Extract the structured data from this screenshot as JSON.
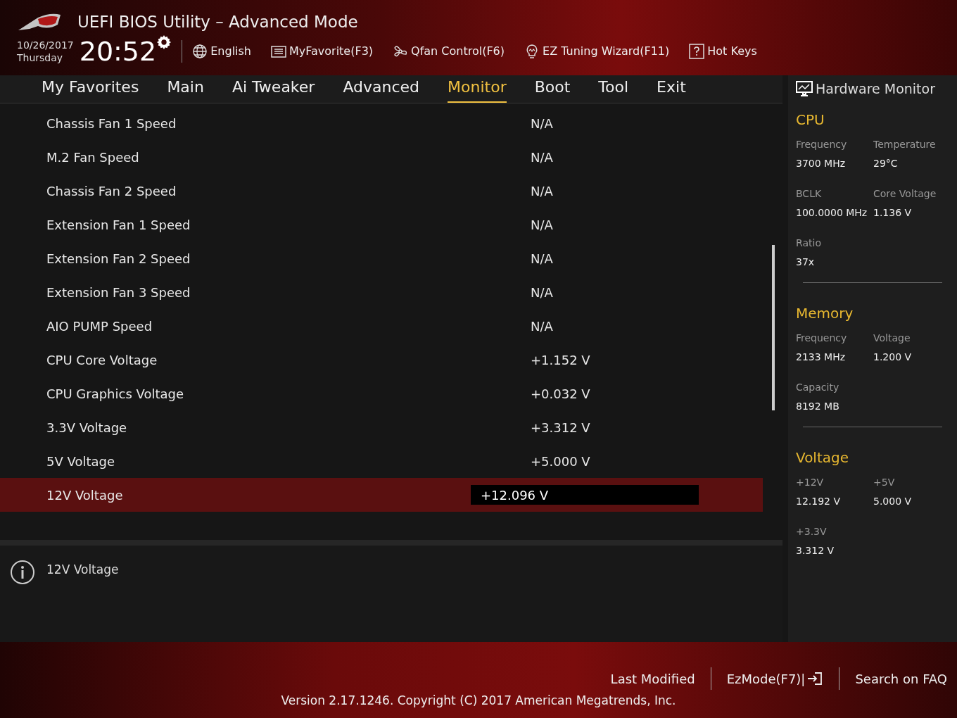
{
  "header": {
    "title": "UEFI BIOS Utility – Advanced Mode",
    "date": "10/26/2017",
    "day": "Thursday",
    "time": "20:52",
    "tools": [
      {
        "kind": "language",
        "label": "English"
      },
      {
        "kind": "favorite",
        "label": "MyFavorite(F3)"
      },
      {
        "kind": "fan",
        "label": "Qfan Control(F6)"
      },
      {
        "kind": "wizard",
        "label": "EZ Tuning Wizard(F11)"
      },
      {
        "kind": "hotkeys",
        "label": "Hot Keys"
      }
    ]
  },
  "tabs": [
    {
      "label": "My Favorites",
      "selected": false
    },
    {
      "label": "Main",
      "selected": false
    },
    {
      "label": "Ai Tweaker",
      "selected": false
    },
    {
      "label": "Advanced",
      "selected": false
    },
    {
      "label": "Monitor",
      "selected": true
    },
    {
      "label": "Boot",
      "selected": false
    },
    {
      "label": "Tool",
      "selected": false
    },
    {
      "label": "Exit",
      "selected": false
    }
  ],
  "rows": [
    {
      "label": "Chassis Fan 1 Speed",
      "value": "N/A",
      "selected": false
    },
    {
      "label": "M.2 Fan Speed",
      "value": "N/A",
      "selected": false
    },
    {
      "label": "Chassis Fan 2 Speed",
      "value": "N/A",
      "selected": false
    },
    {
      "label": "Extension Fan 1 Speed",
      "value": "N/A",
      "selected": false
    },
    {
      "label": "Extension Fan 2 Speed",
      "value": "N/A",
      "selected": false
    },
    {
      "label": "Extension Fan 3 Speed",
      "value": "N/A",
      "selected": false
    },
    {
      "label": "AIO PUMP Speed",
      "value": "N/A",
      "selected": false
    },
    {
      "label": "CPU Core Voltage",
      "value": "+1.152 V",
      "selected": false
    },
    {
      "label": "CPU Graphics Voltage",
      "value": "+0.032 V",
      "selected": false
    },
    {
      "label": "3.3V Voltage",
      "value": "+3.312 V",
      "selected": false
    },
    {
      "label": "5V Voltage",
      "value": "+5.000 V",
      "selected": false
    },
    {
      "label": "12V Voltage",
      "value": "+12.096 V",
      "selected": true
    }
  ],
  "help": {
    "text": "12V Voltage"
  },
  "hardware_monitor": {
    "title": "Hardware Monitor",
    "groups": [
      {
        "title": "CPU",
        "items": [
          {
            "label": "Frequency",
            "value": "3700 MHz"
          },
          {
            "label": "Temperature",
            "value": "29°C"
          },
          {
            "label": "BCLK",
            "value": "100.0000 MHz"
          },
          {
            "label": "Core Voltage",
            "value": "1.136 V"
          },
          {
            "label": "Ratio",
            "value": "37x"
          }
        ]
      },
      {
        "title": "Memory",
        "items": [
          {
            "label": "Frequency",
            "value": "2133 MHz"
          },
          {
            "label": "Voltage",
            "value": "1.200 V"
          },
          {
            "label": "Capacity",
            "value": "8192 MB"
          }
        ]
      },
      {
        "title": "Voltage",
        "items": [
          {
            "label": "+12V",
            "value": "12.192 V"
          },
          {
            "label": "+5V",
            "value": "5.000 V"
          },
          {
            "label": "+3.3V",
            "value": "3.312 V"
          }
        ]
      }
    ]
  },
  "footer": {
    "links": [
      {
        "kind": "plain",
        "label": "Last Modified"
      },
      {
        "kind": "ezmode",
        "label": "EzMode(F7)|"
      },
      {
        "kind": "plain",
        "label": "Search on FAQ"
      }
    ],
    "version": "Version 2.17.1246. Copyright (C) 2017 American Megatrends, Inc."
  }
}
